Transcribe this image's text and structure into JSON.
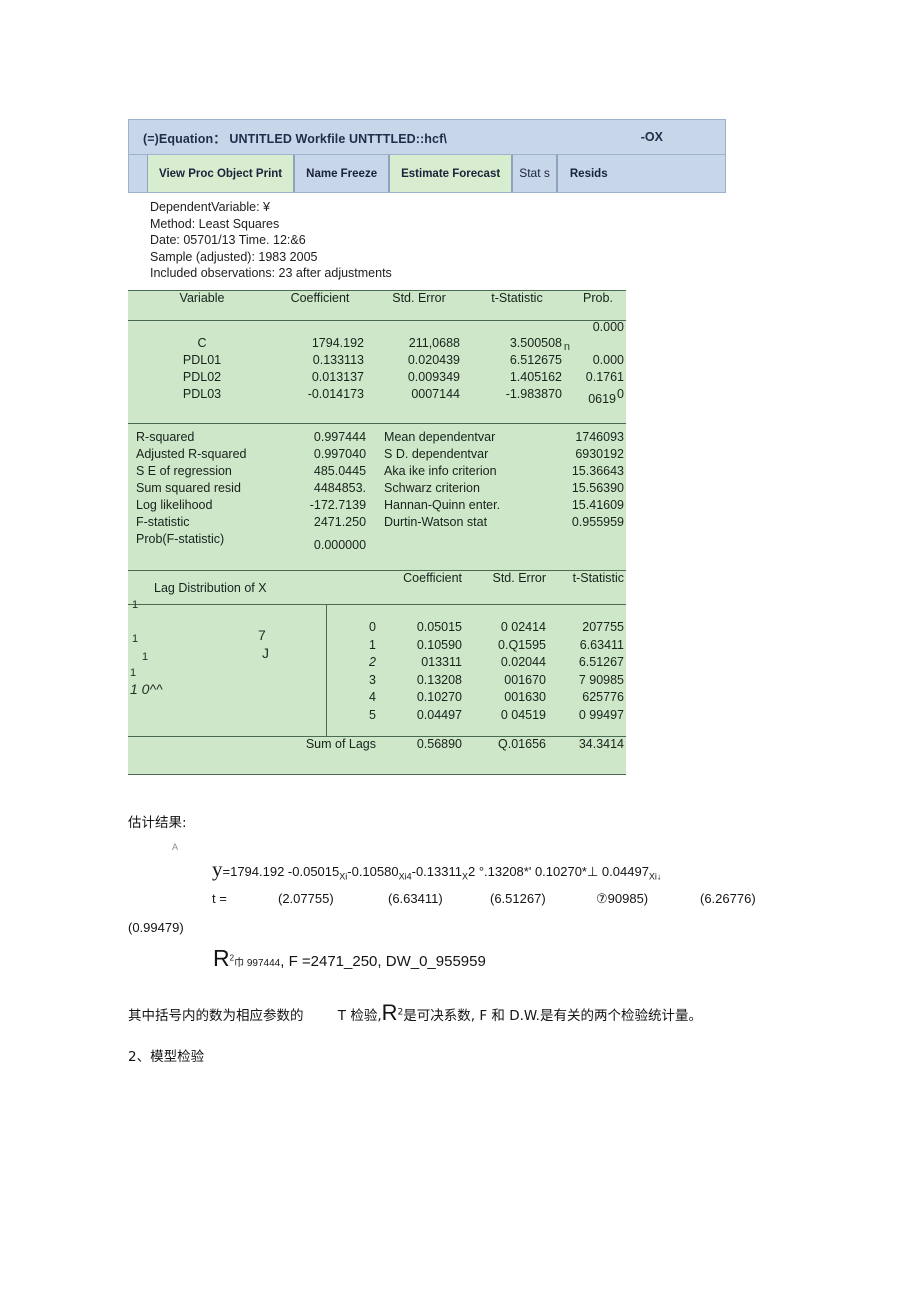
{
  "window": {
    "title": "(=)Equation：  UNTITLED Workfile UNTTTLED::hcf\\",
    "window_buttons": "-OX",
    "toolbar": [
      {
        "label": "View Proc Object Print",
        "style": "green"
      },
      {
        "label": "Name Freeze",
        "style": "blue"
      },
      {
        "label": "Estimate Forecast",
        "style": "green"
      },
      {
        "label": "Stat s",
        "style": "blue"
      },
      {
        "label": "Resids",
        "style": "blue"
      }
    ]
  },
  "output_header": {
    "line1": "DependentVariable: ¥",
    "line2": "Method: Least Squares",
    "line3": "Date: 05701/13 Time. 12:&6",
    "line4": "Sample (adjusted): 1983 2005",
    "line5": "Included observations: 23 after adjustments"
  },
  "coefficient_table": {
    "headers": [
      "Variable",
      "Coefficient",
      "Std. Error",
      "t-Statistic",
      "Prob."
    ],
    "rows": [
      {
        "variable": "C",
        "coefficient": "1794.192",
        "std_error": "211,0688",
        "t_stat": "3.500508",
        "prob": "0.000",
        "prob_extra": ""
      },
      {
        "variable": "PDL01",
        "coefficient": "0.133113",
        "std_error": "0.020439",
        "t_stat": "6.512675",
        "prob": "0.000",
        "prob_extra": ""
      },
      {
        "variable": "PDL02",
        "coefficient": "0.013137",
        "std_error": "0.009349",
        "t_stat": "1.405162",
        "prob": "0.1761",
        "prob_extra": ""
      },
      {
        "variable": "PDL03",
        "coefficient": "-0.014173",
        "std_error": "0007144",
        "t_stat": "-1.983870",
        "prob": "0",
        "prob_extra": "0619"
      }
    ],
    "stray_glyph": "n"
  },
  "statistics": {
    "rows": [
      {
        "label_left": "R-squared",
        "value_left": "0.997444",
        "label_right": "Mean dependentvar",
        "value_right": "1746093"
      },
      {
        "label_left": "Adjusted R-squared",
        "value_left": "0.997040",
        "label_right": "S D. dependentvar",
        "value_right": "6930192"
      },
      {
        "label_left": "S E of regression",
        "value_left": "485.0445",
        "label_right": "Aka ike info criterion",
        "value_right": "15.36643"
      },
      {
        "label_left": "Sum squared resid",
        "value_left": "4484853.",
        "label_right": "Schwarz criterion",
        "value_right": "15.56390"
      },
      {
        "label_left": "Log likelihood",
        "value_left": "-172.7139",
        "label_right": "Hannan-Quinn enter.",
        "value_right": "15.41609"
      },
      {
        "label_left": "F-statistic",
        "value_left": "2471.250",
        "label_right": "Durtin-Watson stat",
        "value_right": "0.955959"
      },
      {
        "label_left": "Prob(F-statistic)",
        "value_left": "0.000000",
        "label_right": "",
        "value_right": ""
      }
    ]
  },
  "lag_distribution": {
    "title": "Lag Distribution of X",
    "headers": [
      "Coefficient",
      "Std. Error",
      "t-Statistic"
    ],
    "rows": [
      {
        "lag": "0",
        "coefficient": "0.05015",
        "std_error": "0 02414",
        "t_stat": "207755"
      },
      {
        "lag": "1",
        "coefficient": "0.10590",
        "std_error": "0.Q1595",
        "t_stat": "6.63411"
      },
      {
        "lag": "2",
        "coefficient": "013311",
        "std_error": "0.02044",
        "t_stat": "6.51267"
      },
      {
        "lag": "3",
        "coefficient": "0.13208",
        "std_error": "001670",
        "t_stat": "7 90985"
      },
      {
        "lag": "4",
        "coefficient": "0.10270",
        "std_error": "001630",
        "t_stat": "625776"
      },
      {
        "lag": "5",
        "coefficient": "0.04497",
        "std_error": "0 04519",
        "t_stat": "0 99497"
      }
    ],
    "ascii_art": [
      "1",
      "1",
      "1",
      "7",
      "J",
      "1",
      "1 0^^"
    ],
    "sum_of_lags": {
      "label": "Sum of Lags",
      "coefficient": "0.56890",
      "std_error": "Q.01656",
      "t_stat": "34.3414"
    }
  },
  "prose": {
    "heading": "估计结果:",
    "faint_mark": "A",
    "equation_lhs": "y",
    "equation_rhs": "=1794.192 -0.05015",
    "eq_sub1": "Xi",
    "eq_part2": "-0.10580",
    "eq_sub2": "Xi4",
    "eq_part3": "-0.13311",
    "eq_sub3": "X",
    "eq_part4": "2 °.13208*' 0.10270*⊥ 0.04497",
    "eq_sub4": "Xi↓",
    "t_label": "t =",
    "t_values": [
      "(2.07755)",
      "(6.63411)",
      "(6.51267)",
      "⑦90985)",
      "(6.26776)"
    ],
    "t_value_last": "(0.99479)",
    "r_symbol": "R",
    "r_sup": "2",
    "r_value": "巾 997444",
    "f_text": ", F =2471_250",
    "dw_text": ", DW_0_955959",
    "note_part1": "其中括号内的数为相应参数的",
    "note_part2": "T 检验,",
    "note_r": "R",
    "note_r_sup": "2",
    "note_part3": "是可决系数, F 和 D.W.是有关的两个检验统计量。",
    "section_next": "2、模型检验"
  }
}
